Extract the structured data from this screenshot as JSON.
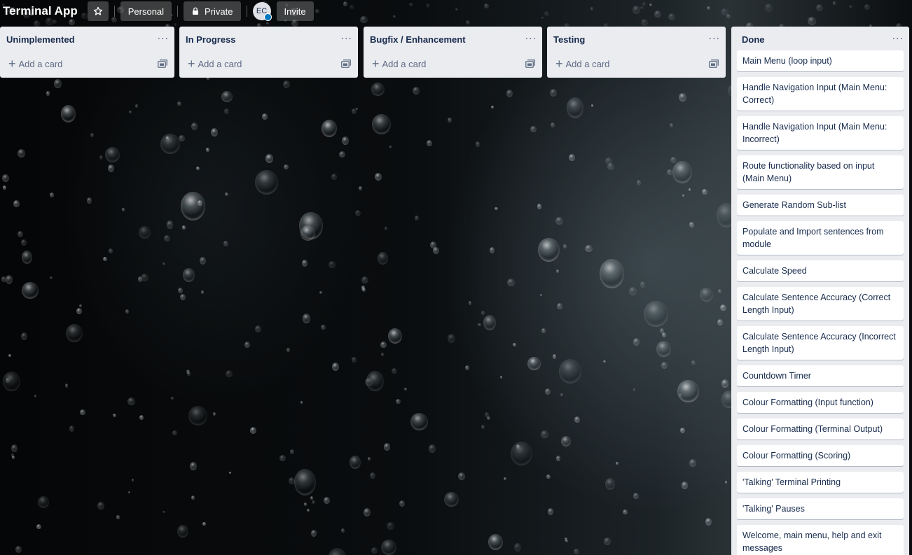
{
  "board": {
    "title": "Terminal App",
    "workspace_label": "Personal",
    "visibility_label": "Private",
    "member_initials": "EC",
    "invite_label": "Invite"
  },
  "lists": [
    {
      "title": "Unimplemented",
      "add_label": "Add a card"
    },
    {
      "title": "In Progress",
      "add_label": "Add a card"
    },
    {
      "title": "Bugfix / Enhancement",
      "add_label": "Add a card"
    },
    {
      "title": "Testing",
      "add_label": "Add a card"
    },
    {
      "title": "Done",
      "cards": [
        "Main Menu (loop input)",
        "Handle Navigation Input (Main Menu: Correct)",
        "Handle Navigation Input (Main Menu: Incorrect)",
        "Route functionality based on input (Main Menu)",
        "Generate Random Sub-list",
        "Populate and Import sentences from module",
        "Calculate Speed",
        "Calculate Sentence Accuracy (Correct Length Input)",
        "Calculate Sentence Accuracy (Incorrect Length Input)",
        "Countdown Timer",
        "Colour Formatting (Input function)",
        "Colour Formatting (Terminal Output)",
        "Colour Formatting (Scoring)",
        "'Talking' Terminal Printing",
        "'Talking' Pauses",
        "Welcome, main menu, help and exit messages"
      ]
    }
  ],
  "icons": {
    "star": "star-icon",
    "lock": "lock-icon",
    "menu": "ellipsis-icon",
    "add": "plus-icon",
    "template": "card-template-icon"
  },
  "colors": {
    "list_bg": "#ebecf0",
    "card_bg": "#ffffff",
    "text": "#172b4d",
    "muted": "#5e6c84"
  }
}
